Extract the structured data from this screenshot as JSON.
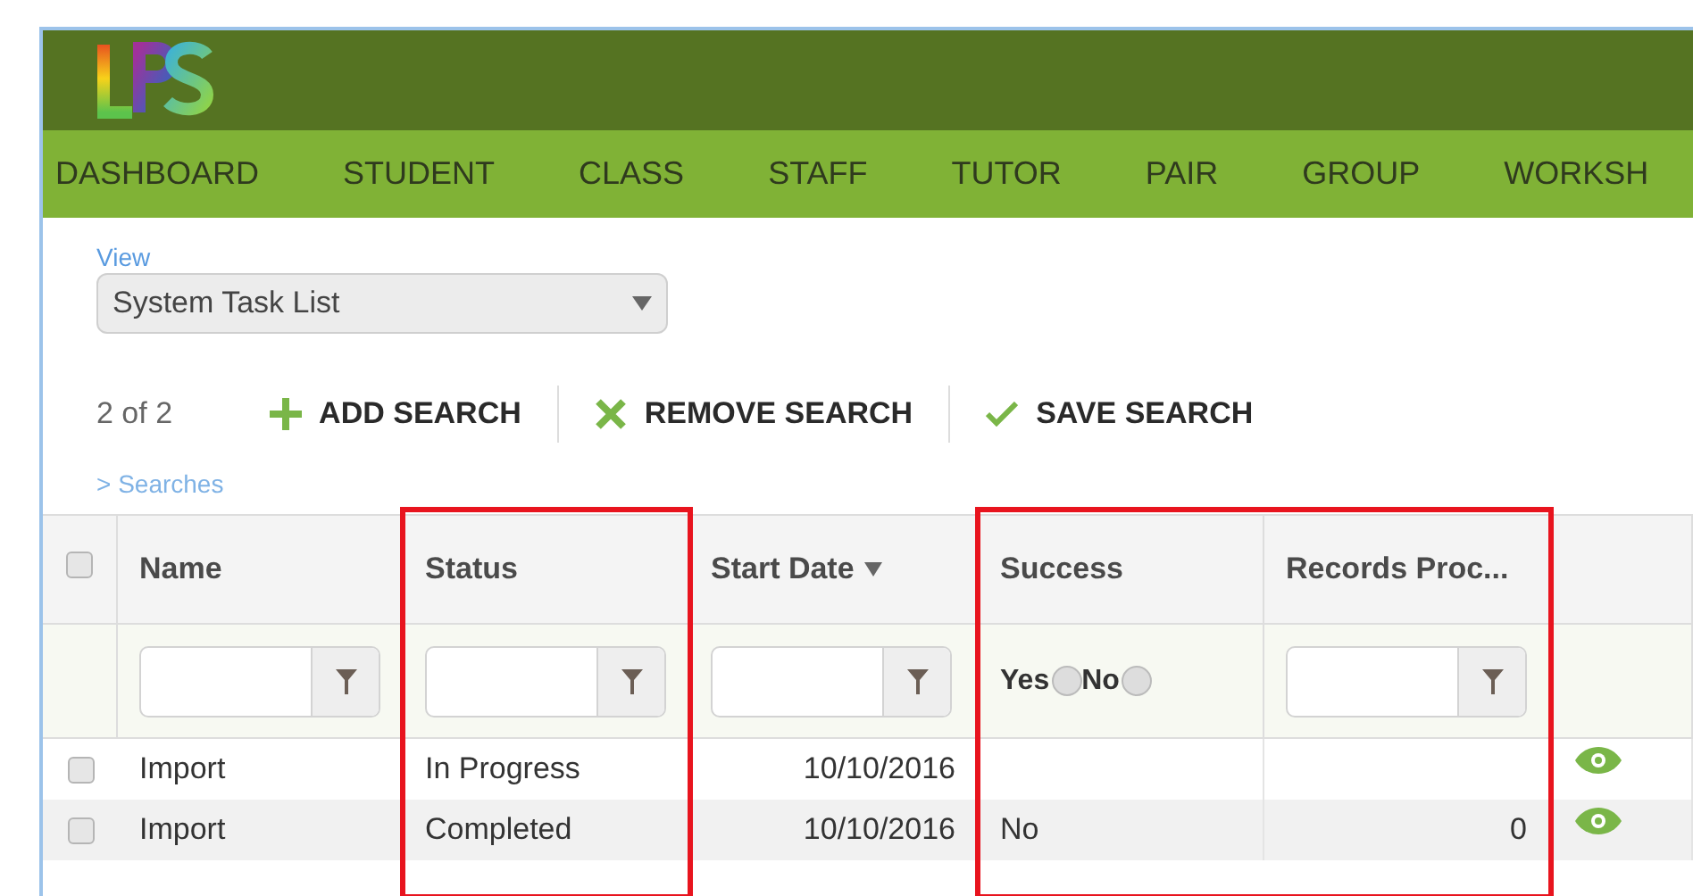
{
  "nav": [
    {
      "label": "DASHBOARD"
    },
    {
      "label": "STUDENT"
    },
    {
      "label": "CLASS"
    },
    {
      "label": "STAFF"
    },
    {
      "label": "TUTOR"
    },
    {
      "label": "PAIR"
    },
    {
      "label": "GROUP"
    },
    {
      "label": "WORKSH"
    }
  ],
  "view": {
    "label": "View",
    "value": "System Task List"
  },
  "toolbar": {
    "count": "2",
    "of": "of",
    "total": "2",
    "actions": [
      {
        "kind": "add",
        "label": "ADD SEARCH"
      },
      {
        "kind": "remove",
        "label": "REMOVE SEARCH"
      },
      {
        "kind": "save",
        "label": "SAVE SEARCH"
      }
    ]
  },
  "searches_link": "> Searches",
  "table": {
    "columns": [
      {
        "label": "Name",
        "kind": "text",
        "highlighted": false,
        "sorted": false
      },
      {
        "label": "Status",
        "kind": "text",
        "highlighted": true,
        "sorted": false
      },
      {
        "label": "Start Date",
        "kind": "text",
        "highlighted": false,
        "sorted": true
      },
      {
        "label": "Success",
        "kind": "radio",
        "options": [
          {
            "label": "Yes",
            "selected": false
          },
          {
            "label": "No",
            "selected": false
          }
        ],
        "highlighted": true,
        "sorted": false
      },
      {
        "label": "Records Proc...",
        "kind": "text",
        "highlighted": true,
        "sorted": false
      }
    ],
    "select_all_checked": false,
    "rows": [
      {
        "checked": false,
        "cells": [
          "Import",
          "In Progress",
          "10/10/2016",
          "",
          ""
        ]
      },
      {
        "checked": false,
        "cells": [
          "Import",
          "Completed",
          "10/10/2016",
          "No",
          "0"
        ]
      }
    ]
  }
}
